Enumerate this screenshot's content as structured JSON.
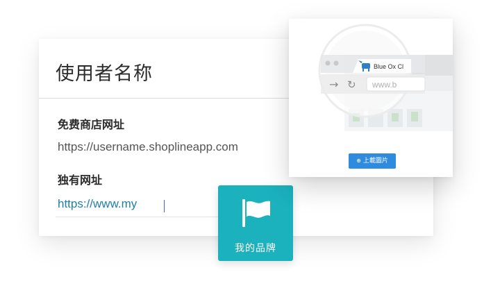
{
  "card": {
    "title": "使用者名称",
    "store_url_label": "免费商店网址",
    "store_url_value": "https://username.shoplineapp.com",
    "unique_url_label": "独有网址",
    "unique_url_value": "https://www.my"
  },
  "brand_tile": {
    "label": "我的品牌",
    "icon": "flag-icon",
    "color": "#1bb1bd"
  },
  "upload_panel": {
    "browser_tab_label": "Blue Ox Cl",
    "address_text": "www.b",
    "upload_button_label": "上載圖片",
    "button_icon": "plus-circle-icon",
    "button_color": "#2f8be0"
  }
}
